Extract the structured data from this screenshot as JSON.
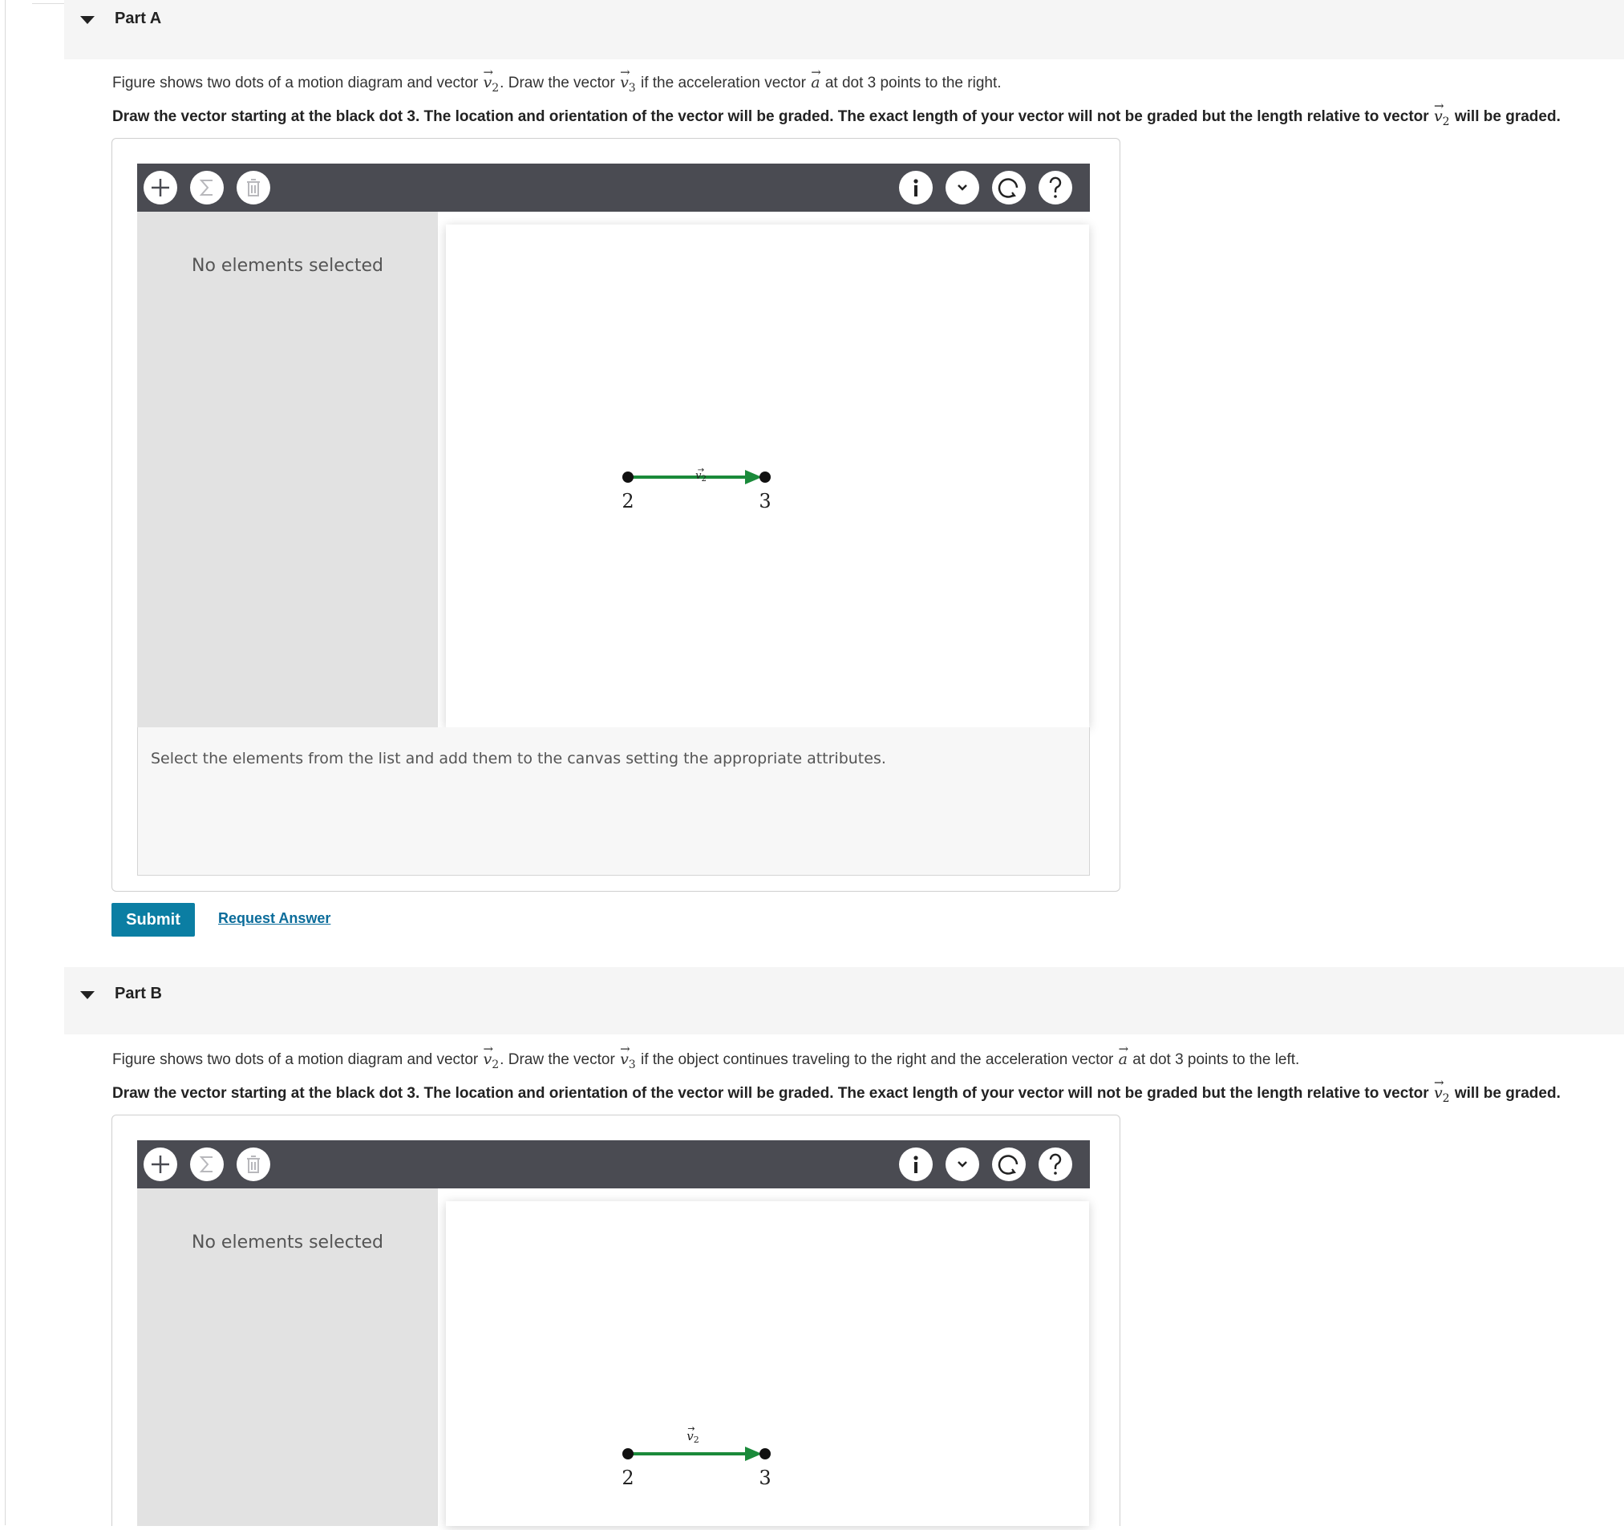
{
  "parts": [
    {
      "title": "Part A",
      "prompt_pre": "Figure shows two dots of a motion diagram and vector ",
      "prompt_mid1": ". Draw the vector ",
      "prompt_mid2": " if the acceleration vector ",
      "prompt_post": " at dot 3 points to the right.",
      "instruction_pre": "Draw the vector starting at the black dot 3. The location and orientation of the vector will be graded. The exact length of your vector will not be graded but the length relative to vector ",
      "instruction_post": " will be graded.",
      "tool": {
        "no_selection": "No elements selected",
        "hint": "Select the elements from the list and add them to the canvas setting the appropriate attributes.",
        "vector_label": "v",
        "dot_left_label": "2",
        "dot_right_label": "3"
      },
      "submit_label": "Submit",
      "request_label": "Request Answer"
    },
    {
      "title": "Part B",
      "prompt_pre": "Figure shows two dots of a motion diagram and vector ",
      "prompt_mid1": ". Draw the vector ",
      "prompt_mid2": " if the object continues traveling to the right and the acceleration vector ",
      "prompt_post": " at dot 3 points to the left.",
      "instruction_pre": "Draw the vector starting at the black dot 3. The location and orientation of the vector will be graded. The exact length of your vector will not be graded but the length relative to vector ",
      "instruction_post": " will be graded.",
      "tool": {
        "no_selection": "No elements selected",
        "vector_label": "v",
        "dot_left_label": "2",
        "dot_right_label": "3"
      }
    }
  ],
  "math": {
    "v": "v",
    "a": "a",
    "sub2": "2",
    "sub3": "3",
    "arrow": "→"
  },
  "toolbar_icons": [
    "plus-icon",
    "sigma-icon",
    "trash-icon",
    "info-icon",
    "chevron-down-icon",
    "reset-icon",
    "help-icon"
  ],
  "colors": {
    "vector": "#1a8a3a",
    "submit": "#0b7ea3",
    "toolbar": "#4a4b52"
  }
}
